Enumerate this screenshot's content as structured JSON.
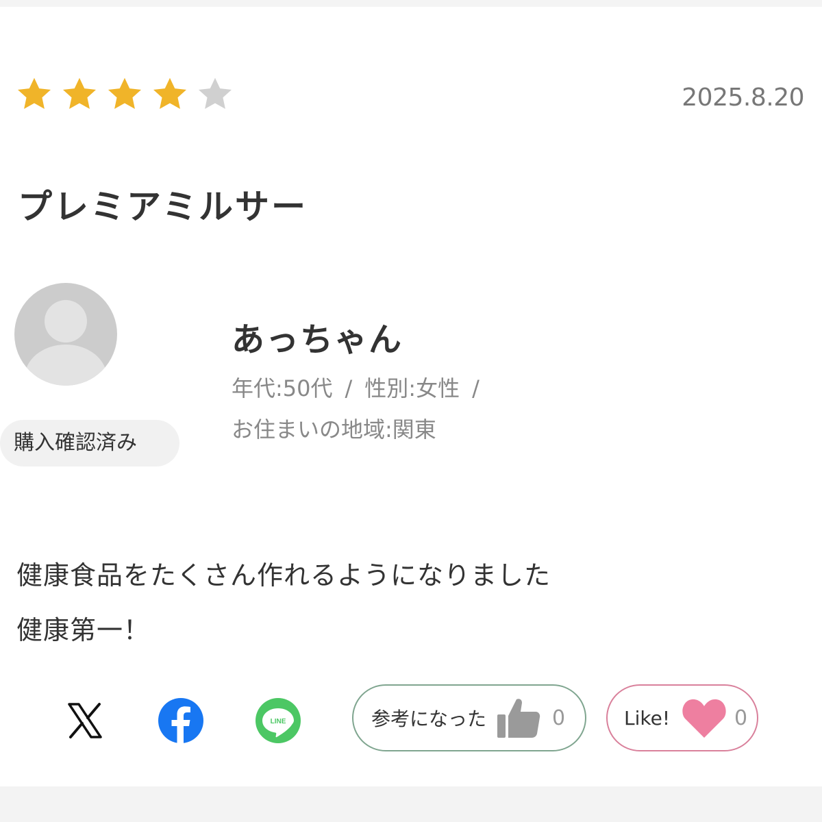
{
  "review": {
    "rating": 4,
    "rating_max": 5,
    "date": "2025.8.20",
    "title": "プレミアミルサー",
    "reviewer": {
      "avatar_icon": "default-user-avatar",
      "nickname": "あっちゃん",
      "age": "年代:50代",
      "gender": "性別:女性",
      "region": "お住まいの地域:関東",
      "separator": "/",
      "badge": "購入確認済み"
    },
    "body_lines": [
      "健康食品をたくさん作れるようになりました",
      "健康第一！"
    ]
  },
  "share": {
    "icons": [
      "x-icon",
      "facebook-icon",
      "line-icon"
    ],
    "line_text": "LINE"
  },
  "actions": {
    "helpful_label": "参考になった",
    "helpful_count": "0",
    "like_label": "Like!",
    "like_count": "0"
  },
  "colors": {
    "star_filled": "#F0B429",
    "star_empty": "#D0D0D0",
    "facebook": "#1877F2",
    "line": "#4CC764",
    "helpful_border": "#7FA58F",
    "like_border": "#D9809B",
    "heart": "#EE7FA0",
    "thumb": "#9A9A9A"
  }
}
